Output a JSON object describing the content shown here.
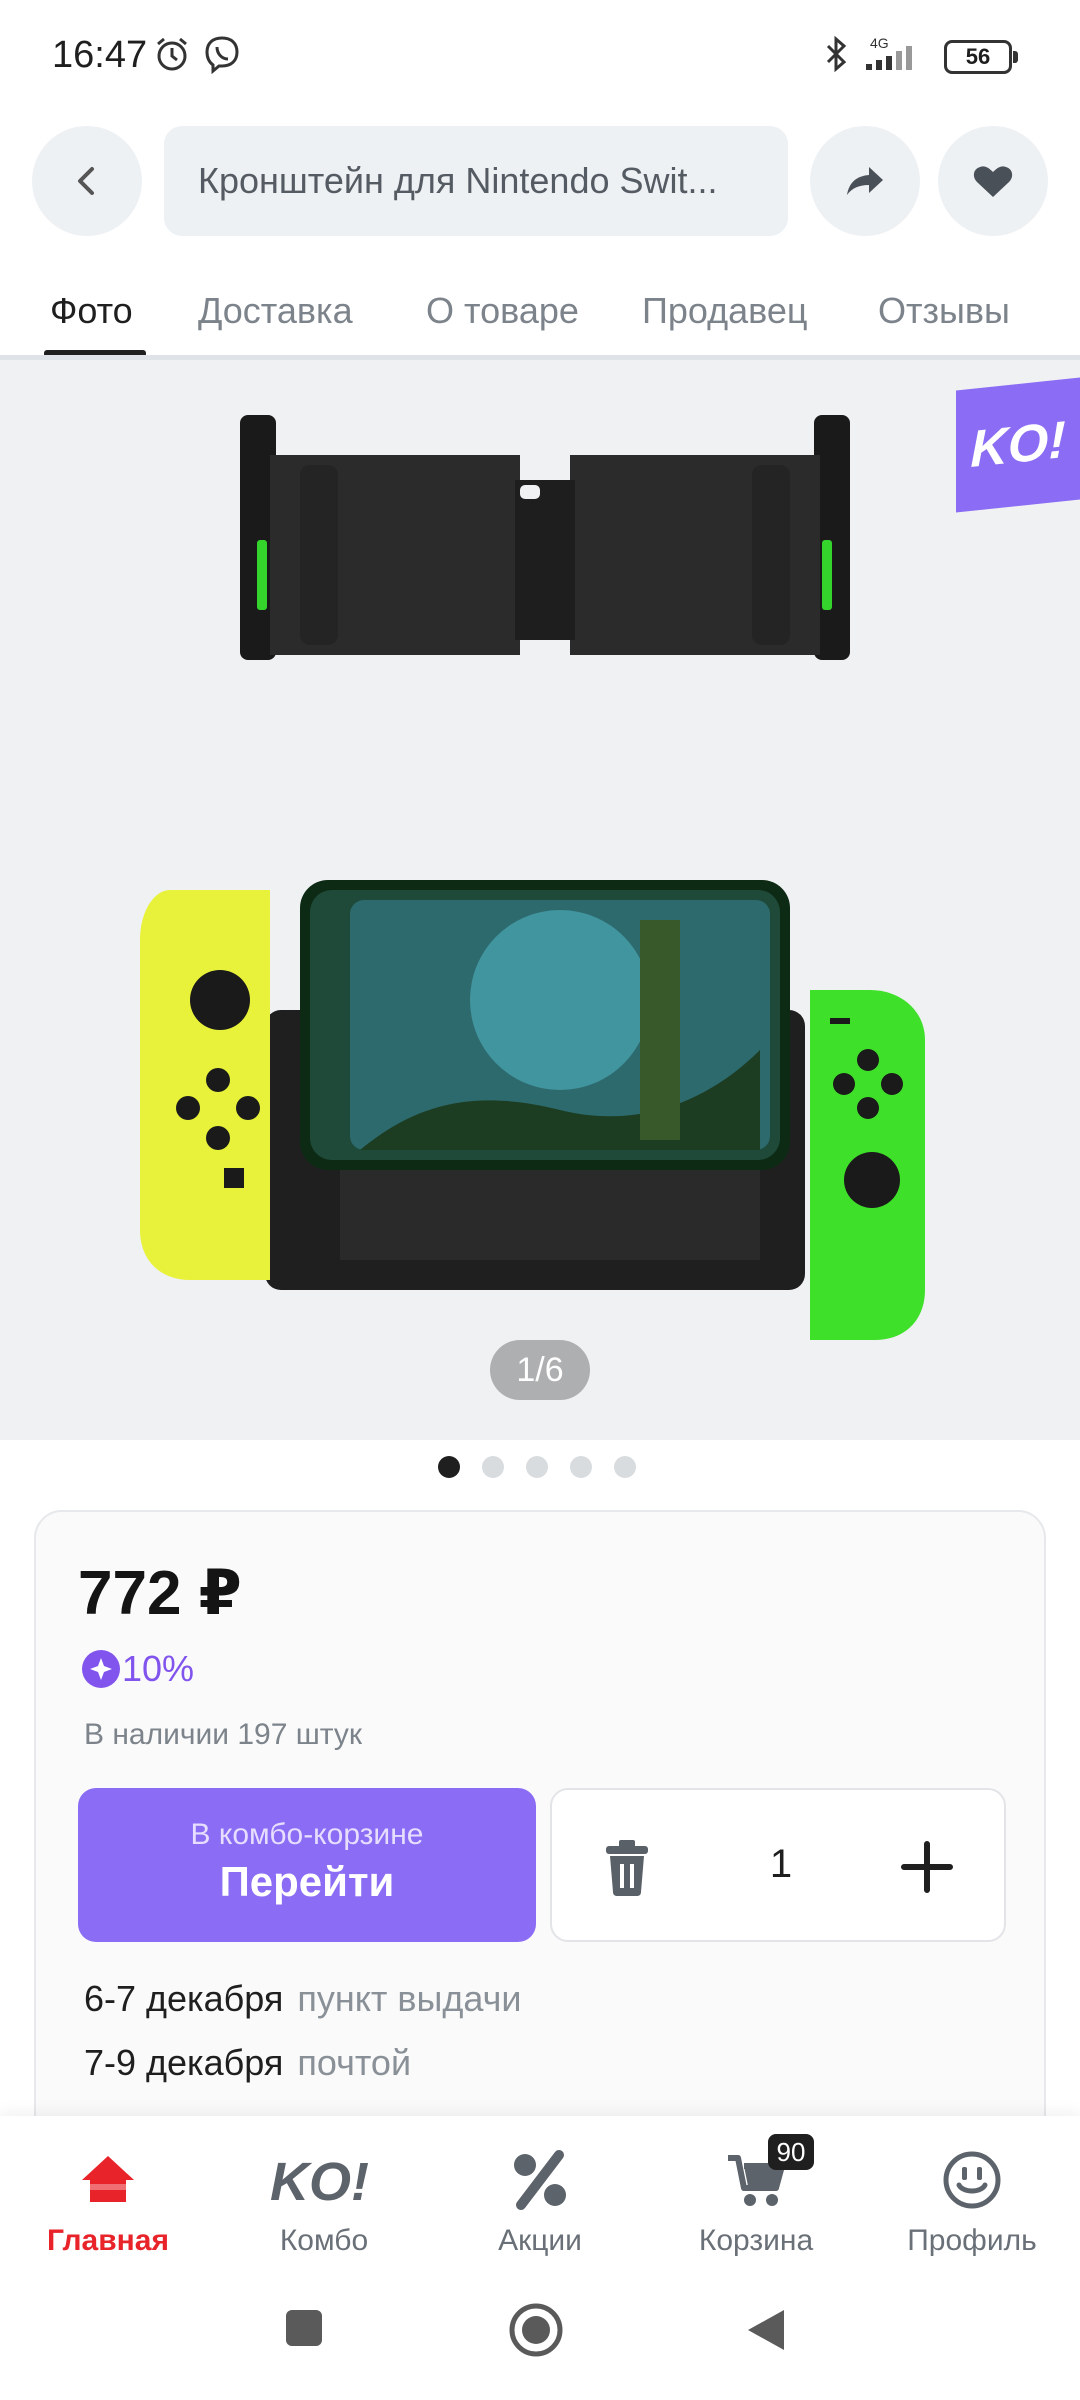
{
  "status_bar": {
    "time": "16:47",
    "network": "4G",
    "battery": "56",
    "icons": [
      "alarm-icon",
      "viber-icon",
      "bluetooth-icon",
      "signal-icon",
      "battery-icon"
    ]
  },
  "header": {
    "search_text": "Кронштейн для Nintendo Swit...",
    "icons": [
      "back-icon",
      "share-icon",
      "heart-icon"
    ]
  },
  "tabs": [
    {
      "label": "Фото",
      "active": true
    },
    {
      "label": "Доставка",
      "active": false
    },
    {
      "label": "О товаре",
      "active": false
    },
    {
      "label": "Продавец",
      "active": false
    },
    {
      "label": "Отзывы",
      "active": false
    }
  ],
  "gallery": {
    "badge": "KO!",
    "counter": "1/6",
    "dots_count": 5,
    "active_dot": 0
  },
  "product": {
    "price": "772 ₽",
    "discount": "10%",
    "stock": "В наличии 197 штук",
    "combo_small": "В комбо-корзине",
    "combo_big": "Перейти",
    "quantity": "1",
    "delivery": [
      {
        "date": "6-7 декабря",
        "type": "пункт выдачи"
      },
      {
        "date": "7-9 декабря",
        "type": "почтой"
      }
    ]
  },
  "bottom_nav": [
    {
      "label": "Главная",
      "icon": "home-icon",
      "active": true
    },
    {
      "label": "Комбо",
      "icon": "ko-icon",
      "active": false
    },
    {
      "label": "Акции",
      "icon": "percent-icon",
      "active": false
    },
    {
      "label": "Корзина",
      "icon": "cart-icon",
      "active": false,
      "badge": "90"
    },
    {
      "label": "Профиль",
      "icon": "smile-icon",
      "active": false
    }
  ],
  "colors": {
    "accent_purple": "#8b6cf5",
    "active_red": "#e8232a",
    "text_dark": "#1f1f1f",
    "text_muted": "#7c838b"
  }
}
